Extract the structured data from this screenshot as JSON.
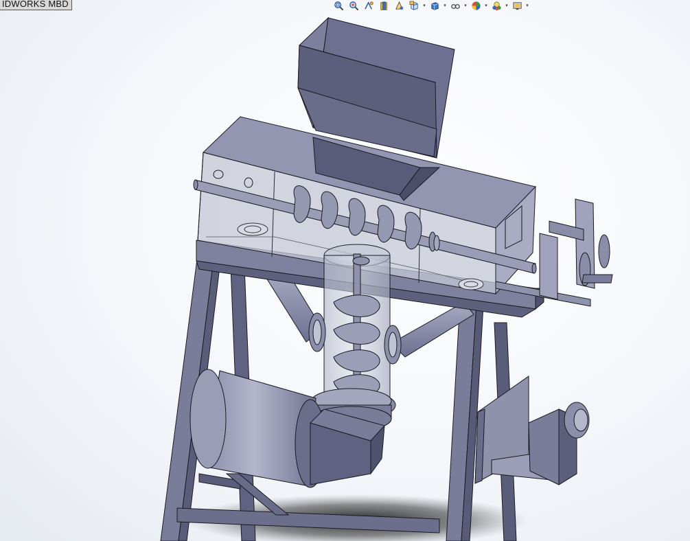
{
  "document": {
    "tab_label": "IDWORKS MBD"
  },
  "heads_up_toolbar": {
    "tools": [
      {
        "icon": "zoom-to-fit-icon"
      },
      {
        "icon": "zoom-to-area-icon"
      },
      {
        "icon": "previous-view-icon"
      },
      {
        "icon": "section-view-icon"
      },
      {
        "icon": "dynamic-annotation-views-icon"
      },
      {
        "icon": "view-orientation-icon",
        "dropdown": true
      },
      {
        "icon": "display-style-icon",
        "dropdown": true
      },
      {
        "icon": "hide-show-items-icon",
        "dropdown": true
      },
      {
        "icon": "edit-appearance-icon",
        "dropdown": true
      },
      {
        "icon": "apply-scene-icon",
        "dropdown": true
      },
      {
        "icon": "view-settings-icon",
        "dropdown": true
      }
    ]
  },
  "colors": {
    "steel_dark": "#5c5f78",
    "steel_mid": "#7e819c",
    "steel_light": "#a9adc4",
    "glass": "#c9ccd9",
    "outline": "#1a1a22",
    "background": "#f1f3f7"
  }
}
